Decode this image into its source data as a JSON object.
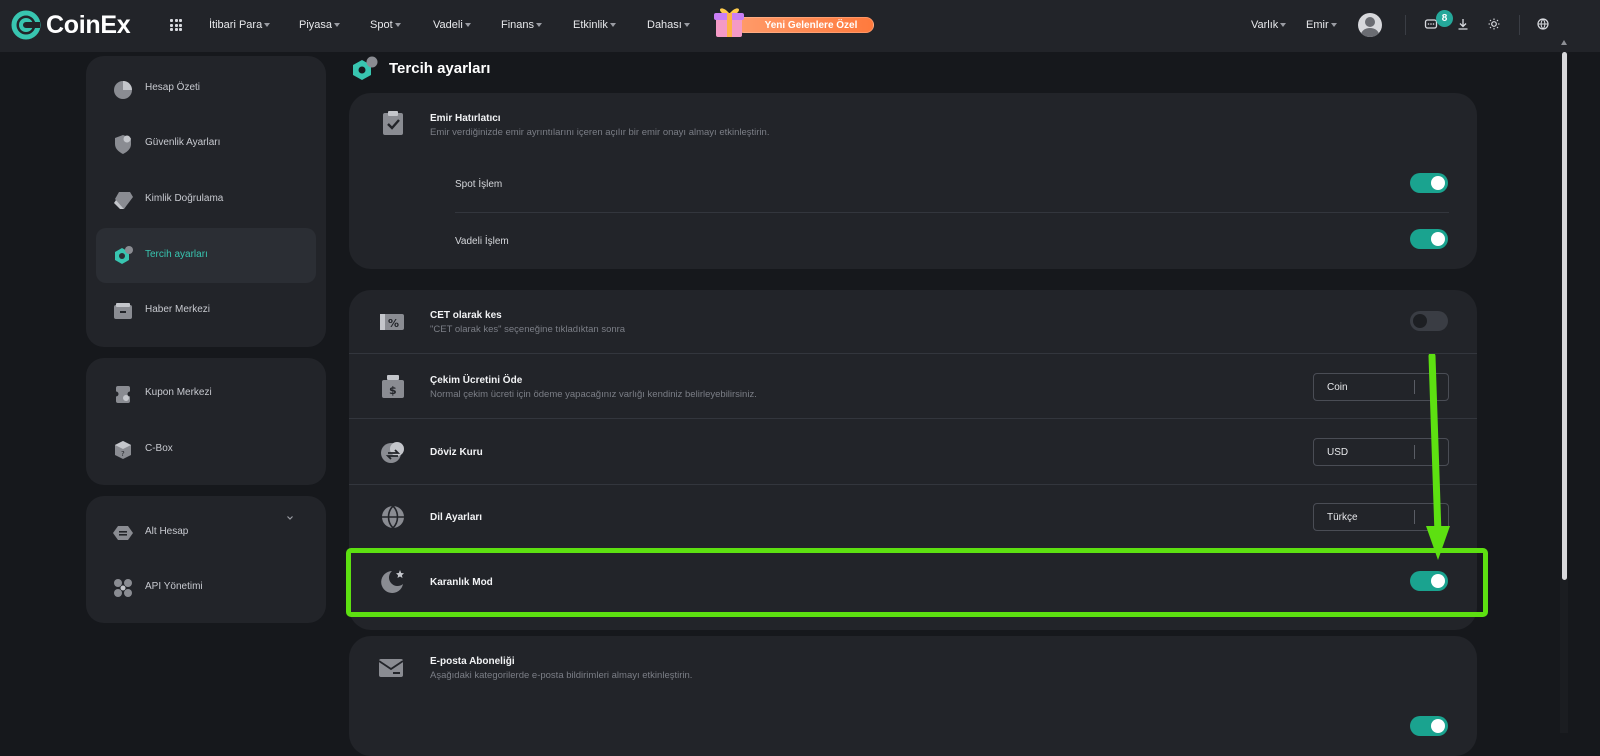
{
  "brand": {
    "name": "CoinEx",
    "accent": "#38c5b0"
  },
  "nav": {
    "items": [
      "İtibari Para",
      "Piyasa",
      "Spot",
      "Vadeli",
      "Finans",
      "Etkinlik",
      "Dahası"
    ],
    "promo": "Yeni Gelenlere Özel",
    "right": [
      "Varlık",
      "Emir"
    ],
    "notification_count": "8",
    "icons": [
      "apps-grid-icon",
      "gift-icon",
      "user-avatar",
      "message-icon",
      "download-icon",
      "theme-sun-icon",
      "globe-icon"
    ]
  },
  "sidebar": {
    "group1": [
      {
        "label": "Hesap Özeti",
        "icon": "pie-chart-icon"
      },
      {
        "label": "Güvenlik Ayarları",
        "icon": "shield-icon"
      },
      {
        "label": "Kimlik Doğrulama",
        "icon": "id-diamond-icon"
      },
      {
        "label": "Tercih ayarları",
        "icon": "settings-hex-icon",
        "active": true
      },
      {
        "label": "Haber Merkezi",
        "icon": "inbox-icon"
      }
    ],
    "group2": [
      {
        "label": "Kupon Merkezi",
        "icon": "coupon-icon"
      },
      {
        "label": "C-Box",
        "icon": "gift-box-icon"
      }
    ],
    "group3": [
      {
        "label": "Alt Hesap",
        "icon": "sub-account-icon"
      },
      {
        "label": "API Yönetimi",
        "icon": "api-icon"
      }
    ]
  },
  "page": {
    "title": "Tercih ayarları"
  },
  "order_reminder": {
    "title": "Emir Hatırlatıcı",
    "desc": "Emir verdiğinizde emir ayrıntılarını içeren açılır bir emir onayı almayı etkinleştirin.",
    "spot_label": "Spot İşlem",
    "spot_on": true,
    "futures_label": "Vadeli İşlem",
    "futures_on": true
  },
  "cet": {
    "title": "CET olarak kes",
    "desc": "\"CET olarak kes\" seçeneğine tıkladıktan sonra",
    "on": false
  },
  "withdraw_fee": {
    "title": "Çekim Ücretini Öde",
    "desc": "Normal çekim ücreti için ödeme yapacağınız varlığı kendiniz belirleyebilirsiniz.",
    "value": "Coin"
  },
  "fx": {
    "title": "Döviz Kuru",
    "value": "USD"
  },
  "language": {
    "title": "Dil Ayarları",
    "value": "Türkçe"
  },
  "dark_mode": {
    "title": "Karanlık Mod",
    "on": true
  },
  "email": {
    "title": "E-posta Aboneliği",
    "desc": "Aşağıdaki kategorilerde e-posta bildirimleri almayı etkinleştirin."
  },
  "annotation_color": "#5de011"
}
